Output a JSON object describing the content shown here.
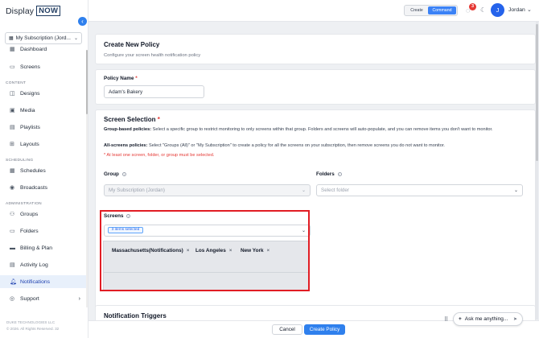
{
  "app": {
    "logo_word": "Display",
    "logo_box": "NOW",
    "collapse_icon": "chevron-left-icon"
  },
  "sidebar": {
    "subscription": "My Subscription (Jord...",
    "sections": {
      "content": "CONTENT",
      "scheduling": "SCHEDULING",
      "administration": "ADMINISTRATION"
    },
    "items": [
      {
        "label": "Dashboard",
        "icon": "dashboard-icon"
      },
      {
        "label": "Screens",
        "icon": "monitor-icon"
      },
      {
        "label": "Designs",
        "icon": "design-icon"
      },
      {
        "label": "Media",
        "icon": "image-icon"
      },
      {
        "label": "Playlists",
        "icon": "playlist-icon"
      },
      {
        "label": "Layouts",
        "icon": "layout-icon"
      },
      {
        "label": "Schedules",
        "icon": "calendar-icon"
      },
      {
        "label": "Broadcasts",
        "icon": "broadcast-icon"
      },
      {
        "label": "Groups",
        "icon": "groups-icon"
      },
      {
        "label": "Folders",
        "icon": "folder-icon"
      },
      {
        "label": "Billing & Plan",
        "icon": "billing-icon"
      },
      {
        "label": "Activity Log",
        "icon": "log-icon"
      },
      {
        "label": "Notifications",
        "icon": "bell-icon",
        "active": true
      },
      {
        "label": "Support",
        "icon": "support-icon"
      }
    ],
    "footer_company": "DUKE TECHNOLOGIES LLC",
    "footer_copyright": "© 2026. All Rights Reserved. 32"
  },
  "topbar": {
    "mode_create": "Create",
    "mode_command": "Command",
    "notification_count": "3",
    "avatar_initial": "J",
    "user_name": "Jordan"
  },
  "page": {
    "title": "Create New Policy",
    "subtitle": "Configure your screen health notification policy"
  },
  "policy_name": {
    "label": "Policy Name",
    "required_mark": "*",
    "value": "Adam's Bakery"
  },
  "screen_selection": {
    "title": "Screen Selection",
    "required_mark": "*",
    "group_based_label": "Group-based policies:",
    "group_based_text": "Select a specific group to restrict monitoring to only screens within that group. Folders and screens will auto-populate, and you can remove items you don't want to monitor.",
    "all_screens_label": "All-screens policies:",
    "all_screens_text": "Select \"Groups (All)\" or \"My Subscription\" to create a policy for all the screens on your subscription, then remove screens you do not want to monitor.",
    "warning": "* At least one screen, folder, or group must be selected.",
    "group_label": "Group",
    "group_value": "My Subscription (Jordan)",
    "folders_label": "Folders",
    "folders_placeholder": "Select folder",
    "screens_label": "Screens",
    "screens_selected": "3 items selected",
    "screens": [
      "Massachusetts(Notifications)",
      "Los Angeles",
      "New York"
    ],
    "remove_glyph": "×"
  },
  "triggers": {
    "title": "Notification Triggers"
  },
  "actions": {
    "cancel": "Cancel",
    "create": "Create Policy"
  },
  "assistant": {
    "plus": "+",
    "prompt": "Ask me anything..."
  }
}
